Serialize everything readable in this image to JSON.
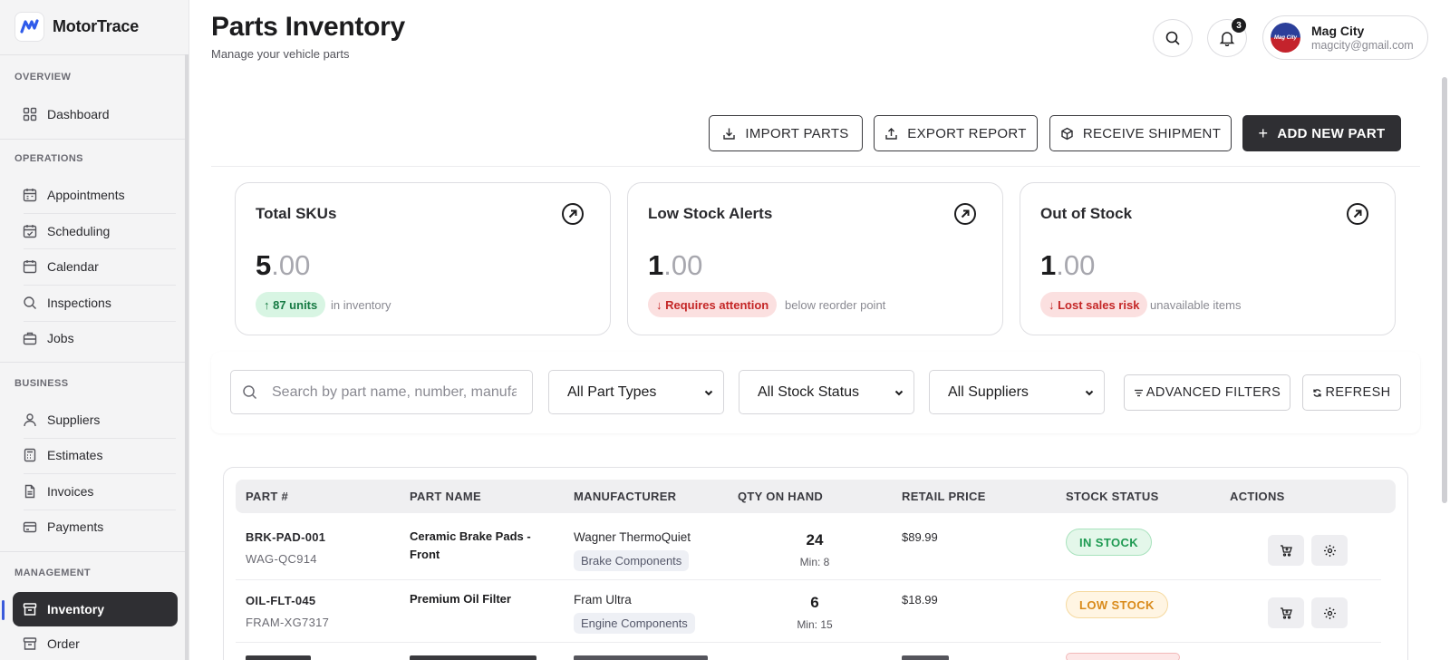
{
  "app": {
    "name": "MotorTrace"
  },
  "sidebar": {
    "sections": [
      {
        "title": "OVERVIEW",
        "items": [
          {
            "label": "Dashboard",
            "icon": "grid-icon"
          }
        ]
      },
      {
        "title": "OPERATIONS",
        "items": [
          {
            "label": "Appointments",
            "icon": "calendar-icon"
          },
          {
            "label": "Scheduling",
            "icon": "calendar-check-icon"
          },
          {
            "label": "Calendar",
            "icon": "calendar-icon"
          },
          {
            "label": "Inspections",
            "icon": "search-icon"
          },
          {
            "label": "Jobs",
            "icon": "briefcase-icon"
          }
        ]
      },
      {
        "title": "BUSINESS",
        "items": [
          {
            "label": "Suppliers",
            "icon": "user-icon"
          },
          {
            "label": "Estimates",
            "icon": "calculator-icon"
          },
          {
            "label": "Invoices",
            "icon": "document-icon"
          },
          {
            "label": "Payments",
            "icon": "credit-card-icon"
          }
        ]
      },
      {
        "title": "MANAGEMENT",
        "items": [
          {
            "label": "Inventory",
            "icon": "archive-icon",
            "active": true
          },
          {
            "label": "Order",
            "icon": "archive-icon"
          }
        ]
      }
    ]
  },
  "header": {
    "title": "Parts Inventory",
    "subtitle": "Manage your vehicle parts",
    "notification_count": "3",
    "user": {
      "name": "Mag City",
      "email": "magcity@gmail.com",
      "avatar_text": "Mag City"
    }
  },
  "actions": {
    "import": "IMPORT PARTS",
    "export": "EXPORT REPORT",
    "receive": "RECEIVE SHIPMENT",
    "add": "ADD NEW PART"
  },
  "stats": [
    {
      "title": "Total SKUs",
      "value_int": "5",
      "value_dec": ".00",
      "badge": "↑ 87 units",
      "badge_kind": "green",
      "note": "in inventory"
    },
    {
      "title": "Low Stock Alerts",
      "value_int": "1",
      "value_dec": ".00",
      "badge": "↓ Requires attention",
      "badge_kind": "red",
      "note": "below reorder point"
    },
    {
      "title": "Out of Stock",
      "value_int": "1",
      "value_dec": ".00",
      "badge": "↓ Lost sales risk",
      "badge_kind": "red",
      "note": "unavailable items"
    }
  ],
  "filters": {
    "search_placeholder": "Search by part name, number, manufacturer...",
    "part_types": "All Part Types",
    "stock_status": "All Stock Status",
    "suppliers": "All Suppliers",
    "advanced": "ADVANCED FILTERS",
    "refresh": "REFRESH"
  },
  "table": {
    "columns": [
      "PART #",
      "PART NAME",
      "MANUFACTURER",
      "QTY ON HAND",
      "RETAIL PRICE",
      "STOCK STATUS",
      "ACTIONS"
    ],
    "rows": [
      {
        "part_no": "BRK-PAD-001",
        "sku": "WAG-QC914",
        "name": "Ceramic Brake Pads - Front",
        "manufacturer": "Wagner ThermoQuiet",
        "category": "Brake Components",
        "qty": "24",
        "min": "Min: 8",
        "price": "$89.99",
        "status": "IN STOCK",
        "status_kind": "in"
      },
      {
        "part_no": "OIL-FLT-045",
        "sku": "FRAM-XG7317",
        "name": "Premium Oil Filter",
        "manufacturer": "Fram Ultra",
        "category": "Engine Components",
        "qty": "6",
        "min": "Min: 15",
        "price": "$18.99",
        "status": "LOW STOCK",
        "status_kind": "low"
      }
    ]
  },
  "colors": {
    "primary": "#2f2f33",
    "accent": "#3b5bdb",
    "success": "#1f9a52",
    "warning": "#d98a1a",
    "danger": "#c42626"
  }
}
